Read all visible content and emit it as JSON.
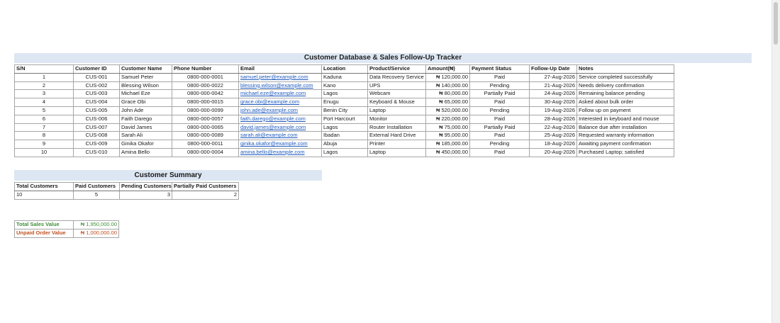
{
  "tracker": {
    "title": "Customer Database & Sales Follow-Up Tracker",
    "headers": [
      "S/N",
      "Customer ID",
      "Customer Name",
      "Phone Number",
      "Email",
      "Location",
      "Product/Service",
      "Amount(₦)",
      "Payment Status",
      "Follow-Up Date",
      "Notes"
    ],
    "rows": [
      [
        "1",
        "CUS-001",
        "Samuel Peter",
        "0800-000-0001",
        "samuel.peter@example.com",
        "Kaduna",
        "Data Recovery Service",
        "₦ 120,000.00",
        "Paid",
        "27-Aug-2026",
        "Service completed successfully"
      ],
      [
        "2",
        "CUS-002",
        "Blessing Wilson",
        "0800-000-0022",
        "blessing.wilson@example.com",
        "Kano",
        "UPS",
        "₦ 140,000.00",
        "Pending",
        "21-Aug-2026",
        "Needs delivery confirmation"
      ],
      [
        "3",
        "CUS-003",
        "Michael Eze",
        "0800-000-0042",
        "michael.eze@example.com",
        "Lagos",
        "Webcam",
        "₦ 80,000.00",
        "Partially Paid",
        "24-Aug-2026",
        "Remaining balance pending"
      ],
      [
        "4",
        "CUS-004",
        "Grace Obi",
        "0800-000-0015",
        "grace.obi@example.com",
        "Enugu",
        "Keyboard & Mouse",
        "₦ 65,000.00",
        "Paid",
        "30-Aug-2026",
        "Asked about bulk order"
      ],
      [
        "5",
        "CUS-005",
        "John Ade",
        "0800-000-0099",
        "john.ade@example.com",
        "Benin City",
        "Laptop",
        "₦ 520,000.00",
        "Pending",
        "19-Aug-2026",
        "Follow up on payment"
      ],
      [
        "6",
        "CUS-006",
        "Faith Darego",
        "0800-000-0057",
        "faith.darego@example.com",
        "Port Harcourt",
        "Monitor",
        "₦ 220,000.00",
        "Paid",
        "28-Aug-2026",
        "Interested in keyboard and mouse"
      ],
      [
        "7",
        "CUS-007",
        "David James",
        "0800-000-0065",
        "david.james@example.com",
        "Lagos",
        "Router Installation",
        "₦ 75,000.00",
        "Partially Paid",
        "22-Aug-2026",
        "Balance due after installation"
      ],
      [
        "8",
        "CUS-008",
        "Sarah Ali",
        "0800-000-0089",
        "sarah.ali@example.com",
        "Ibadan",
        "External Hard Drive",
        "₦ 95,000.00",
        "Paid",
        "25-Aug-2026",
        "Requested warranty information"
      ],
      [
        "9",
        "CUS-009",
        "Ginika Okafor",
        "0800-000-0011",
        "ginika.okafor@example.com",
        "Abuja",
        "Printer",
        "₦ 185,000.00",
        "Pending",
        "18-Aug-2026",
        "Awaiting payment confirmation"
      ],
      [
        "10",
        "CUS-010",
        "Amina Bello",
        "0800-000-0004",
        "amina.bello@example.com",
        "Lagos",
        "Laptop",
        "₦ 450,000.00",
        "Paid",
        "20-Aug-2026",
        "Purchased Laptop; satisfied"
      ]
    ]
  },
  "summary": {
    "title": "Customer Summary",
    "headers": [
      "Total Customers",
      "Paid Customers",
      "Pending Customers",
      "Partially Paid Customers"
    ],
    "values": [
      "10",
      "5",
      "3",
      "2"
    ]
  },
  "totals": {
    "sales_label": "Total Sales Value",
    "sales_value": "₦ 1,950,000.00",
    "unpaid_label": "Unpaid Order Value",
    "unpaid_value": "₦ 1,000,000.00"
  },
  "colors": {
    "header_fill": "#dde7f3",
    "link": "#1f5bbf",
    "sales_green": "#3f8f3a",
    "unpaid_orange": "#c0501f"
  }
}
